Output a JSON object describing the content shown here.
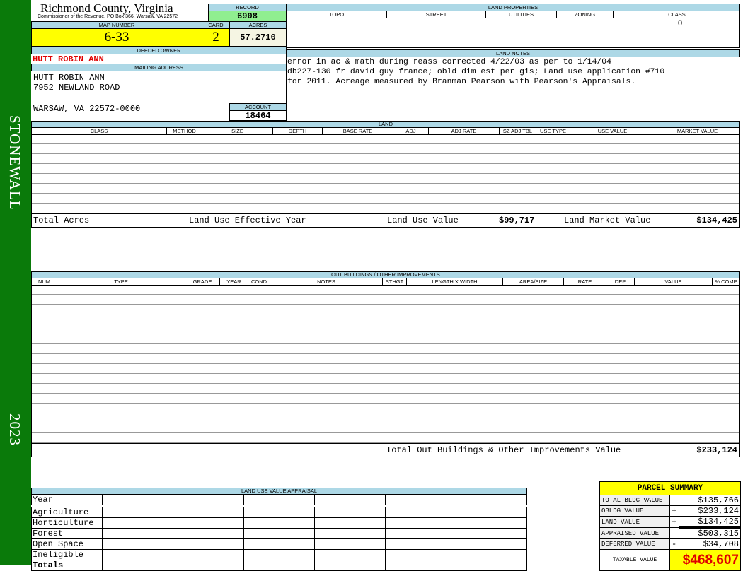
{
  "sidebar": {
    "district": "STONEWALL",
    "year": "2023"
  },
  "header": {
    "county": "Richmond County, Virginia",
    "subtitle": "Commissioner of the Revenue, PO Box 366, Warsaw, VA 22572"
  },
  "record": {
    "label": "RECORD",
    "value": "6908"
  },
  "map": {
    "map_label": "MAP NUMBER",
    "map_value": "6-33",
    "card_label": "CARD",
    "card_value": "2",
    "acres_label": "ACRES",
    "acres_value": "57.2710"
  },
  "owner": {
    "deeded_label": "DEEDED OWNER",
    "deeded_name": "HUTT ROBIN ANN",
    "mailing_label": "MAILING ADDRESS",
    "address": [
      "HUTT ROBIN ANN",
      "7952 NEWLAND ROAD",
      "WARSAW, VA 22572-0000"
    ],
    "account_label": "ACCOUNT",
    "account_value": "18464"
  },
  "land_properties": {
    "title": "LAND PROPERTIES",
    "columns": [
      "TOPO",
      "STREET",
      "UTILITIES",
      "ZONING",
      "CLASS"
    ],
    "class_value": "0"
  },
  "land_notes": {
    "title": "LAND NOTES",
    "lines": [
      "error in ac & math during reass corrected 4/22/03 as per to 1/14/04",
      "db227-130 fr david guy france; obld dim est per gis; Land use application #710",
      "for 2011. Acreage measured by Branman Pearson with Pearson's Appraisals."
    ]
  },
  "land": {
    "title": "LAND",
    "columns": [
      "CLASS",
      "METHOD",
      "SIZE",
      "DEPTH",
      "BASE RATE",
      "ADJ",
      "ADJ RATE",
      "SZ ADJ TBL",
      "USE TYPE",
      "USE VALUE",
      "MARKET VALUE"
    ],
    "total_acres_label": "Total Acres",
    "effective_year_label": "Land Use Effective Year",
    "use_value_label": "Land Use Value",
    "use_value": "$99,717",
    "market_value_label": "Land Market Value",
    "market_value": "$134,425"
  },
  "outbuildings": {
    "title": "OUT BUILDINGS / OTHER IMPROVEMENTS",
    "columns": [
      "NUM",
      "TYPE",
      "GRADE",
      "YEAR",
      "COND",
      "NOTES",
      "STHGT",
      "LENGTH X WIDTH",
      "AREA/SIZE",
      "RATE",
      "DEP",
      "VALUE",
      "% COMP"
    ],
    "total_label": "Total Out Buildings & Other Improvements Value",
    "total_value": "$233,124"
  },
  "land_use_appraisal": {
    "title": "LAND USE VALUE APPRAISAL",
    "rows": [
      "Year",
      "Agriculture",
      "Horticulture",
      "Forest",
      "Open Space",
      "Ineligible",
      "Totals"
    ]
  },
  "parcel_summary": {
    "title": "PARCEL SUMMARY",
    "rows": [
      {
        "label": "TOTAL BLDG VALUE",
        "sign": "",
        "value": "$135,766"
      },
      {
        "label": "OBLDG VALUE",
        "sign": "+",
        "value": "$233,124"
      },
      {
        "label": "LAND VALUE",
        "sign": "+",
        "value": "$134,425"
      },
      {
        "label": "APPRAISED VALUE",
        "sign": "",
        "value": "$503,315"
      },
      {
        "label": "DEFERRED VALUE",
        "sign": "-",
        "value": "$34,708"
      }
    ],
    "taxable_label": "TAXABLE VALUE",
    "taxable_value": "$468,607"
  },
  "colors": {
    "sidebar": "#0a7a0a",
    "header_blue": "#add8e6",
    "highlight_yellow": "#ffff00",
    "record_green": "#90ee90",
    "owner_red": "#e00000"
  }
}
